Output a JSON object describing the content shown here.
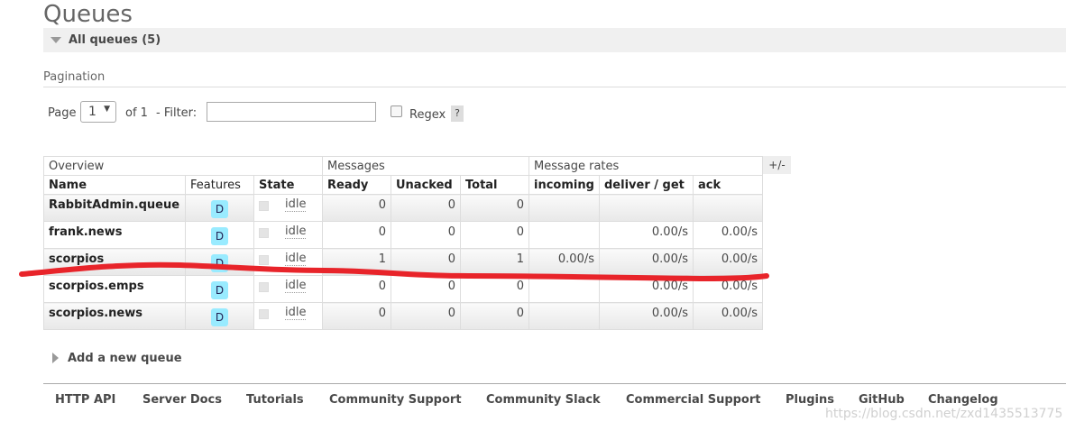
{
  "page": {
    "title": "Queues"
  },
  "section": {
    "label": "All queues (5)"
  },
  "pagination": {
    "heading": "Pagination",
    "page_label": "Page",
    "page_value": "1",
    "of_label": "of 1",
    "filter_label": "- Filter:",
    "filter_value": "",
    "regex_label": "Regex",
    "help_label": "?"
  },
  "table": {
    "groups": [
      "Overview",
      "Messages",
      "Message rates"
    ],
    "columns": [
      "Name",
      "Features",
      "State",
      "Ready",
      "Unacked",
      "Total",
      "incoming",
      "deliver / get",
      "ack"
    ],
    "plus_minus": "+/-",
    "rows": [
      {
        "name": "RabbitAdmin.queue",
        "feature": "D",
        "state": "idle",
        "ready": "0",
        "unacked": "0",
        "total": "0",
        "incoming": "",
        "deliver_get": "",
        "ack": ""
      },
      {
        "name": "frank.news",
        "feature": "D",
        "state": "idle",
        "ready": "0",
        "unacked": "0",
        "total": "0",
        "incoming": "",
        "deliver_get": "0.00/s",
        "ack": "0.00/s"
      },
      {
        "name": "scorpios",
        "feature": "D",
        "state": "idle",
        "ready": "1",
        "unacked": "0",
        "total": "1",
        "incoming": "0.00/s",
        "deliver_get": "0.00/s",
        "ack": "0.00/s"
      },
      {
        "name": "scorpios.emps",
        "feature": "D",
        "state": "idle",
        "ready": "0",
        "unacked": "0",
        "total": "0",
        "incoming": "",
        "deliver_get": "0.00/s",
        "ack": "0.00/s"
      },
      {
        "name": "scorpios.news",
        "feature": "D",
        "state": "idle",
        "ready": "0",
        "unacked": "0",
        "total": "0",
        "incoming": "",
        "deliver_get": "0.00/s",
        "ack": "0.00/s"
      }
    ]
  },
  "add_queue": {
    "label": "Add a new queue"
  },
  "footer": {
    "links": [
      "HTTP API",
      "Server Docs",
      "Tutorials",
      "Community Support",
      "Community Slack",
      "Commercial Support",
      "Plugins",
      "GitHub",
      "Changelog"
    ]
  },
  "watermark": "https://blog.csdn.net/zxd1435513775",
  "colors": {
    "feature_badge": "#99ebff",
    "annotation_line": "#e8242a"
  }
}
